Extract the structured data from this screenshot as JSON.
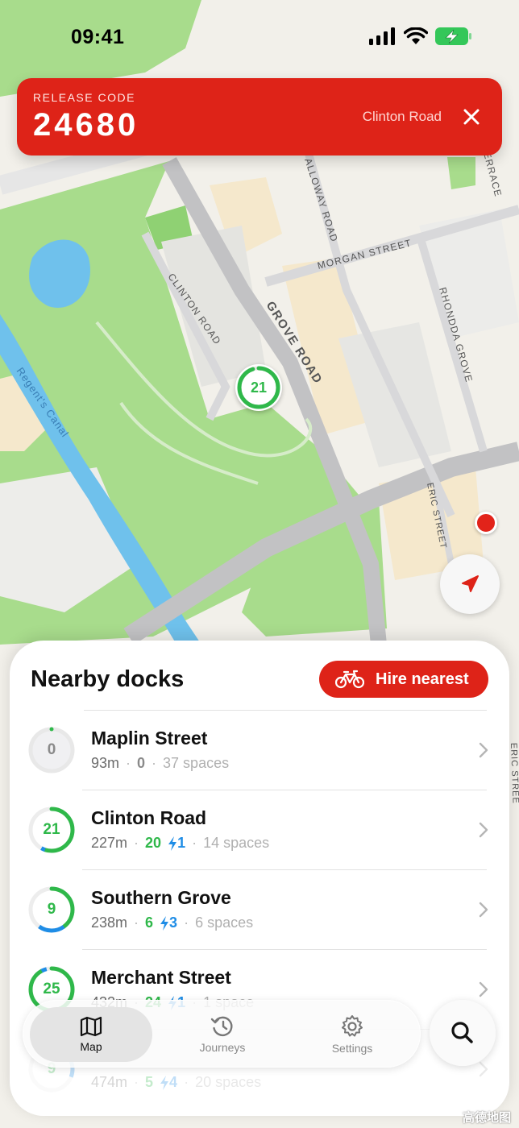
{
  "status_bar": {
    "time": "09:41",
    "battery_color": "#34c759"
  },
  "release": {
    "label": "RELEASE CODE",
    "code": "24680",
    "station": "Clinton Road"
  },
  "map": {
    "labels": {
      "grove_road": "GROVE ROAD",
      "clinton_road": "CLINTON ROAD",
      "morgan_street": "MORGAN STREET",
      "galloway_road": "ALLOWAY ROAD",
      "rhondda_grove": "RHONDDA GROVE",
      "eric_street": "ERIC STREET",
      "terrace": "ERRACE",
      "regents_canal": "Regent's Canal",
      "eric_street_right": "ERIC STREE"
    },
    "marker_count": "21",
    "marker_fraction": 0.95,
    "attribution": "高德地图",
    "accent_color": "#de2318",
    "park_color": "#a8dc8c",
    "water_color": "#6fc1ec"
  },
  "sheet": {
    "title": "Nearby docks",
    "hire_label": "Hire nearest",
    "docks": [
      {
        "name": "Maplin Street",
        "distance": "93m",
        "count": "0",
        "bikes": "0",
        "ebikes": "",
        "spaces": "37 spaces",
        "fill_fraction": 0.0,
        "ebike_fraction": 0.0
      },
      {
        "name": "Clinton Road",
        "distance": "227m",
        "count": "21",
        "bikes": "20",
        "ebikes": "1",
        "spaces": "14 spaces",
        "fill_fraction": 0.58,
        "ebike_fraction": 0.03
      },
      {
        "name": "Southern Grove",
        "distance": "238m",
        "count": "9",
        "bikes": "6",
        "ebikes": "3",
        "spaces": "6 spaces",
        "fill_fraction": 0.6,
        "ebike_fraction": 0.2
      },
      {
        "name": "Merchant Street",
        "distance": "432m",
        "count": "25",
        "bikes": "24",
        "ebikes": "1",
        "spaces": "1 space",
        "fill_fraction": 0.96,
        "ebike_fraction": 0.04
      },
      {
        "name": "",
        "distance": "474m",
        "count": "9",
        "bikes": "5",
        "ebikes": "4",
        "spaces": "20 spaces",
        "fill_fraction": 0.31,
        "ebike_fraction": 0.14
      }
    ]
  },
  "tabs": [
    {
      "label": "Map",
      "icon": "map-icon",
      "active": true
    },
    {
      "label": "Journeys",
      "icon": "history-icon",
      "active": false
    },
    {
      "label": "Settings",
      "icon": "gear-icon",
      "active": false
    }
  ],
  "colors": {
    "bikes_green": "#2fb84a",
    "ebike_blue": "#1f8de6",
    "empty_gray": "#d4d4d4"
  }
}
